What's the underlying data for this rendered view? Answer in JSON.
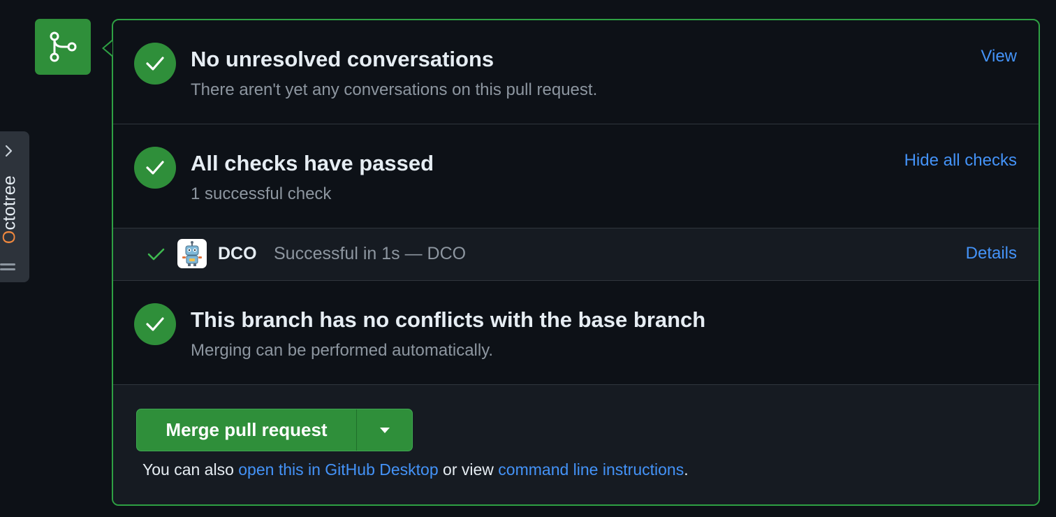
{
  "octotree": {
    "label_accent": "O",
    "label_rest": "ctotree"
  },
  "conversations": {
    "title": "No unresolved conversations",
    "subtitle": "There aren't yet any conversations on this pull request.",
    "link": "View"
  },
  "checks": {
    "title": "All checks have passed",
    "subtitle": "1 successful check",
    "link": "Hide all checks",
    "items": [
      {
        "name": "DCO",
        "status": "Successful in 1s — DCO",
        "link": "Details"
      }
    ]
  },
  "conflicts": {
    "title": "This branch has no conflicts with the base branch",
    "subtitle": "Merging can be performed automatically."
  },
  "merge": {
    "button_label": "Merge pull request",
    "footer_prefix": "You can also ",
    "footer_link1": "open this in GitHub Desktop",
    "footer_middle": " or view ",
    "footer_link2": "command line instructions",
    "footer_suffix": "."
  },
  "colors": {
    "success_green": "#2f8f3a",
    "border_green": "#2ea043",
    "link_blue": "#4493f8",
    "octotree_accent": "#f0883e"
  },
  "icons": [
    "chevron-right-icon",
    "drag-handle-icon",
    "git-merge-icon",
    "check-icon",
    "dco-bot-icon",
    "triangle-down-icon"
  ]
}
